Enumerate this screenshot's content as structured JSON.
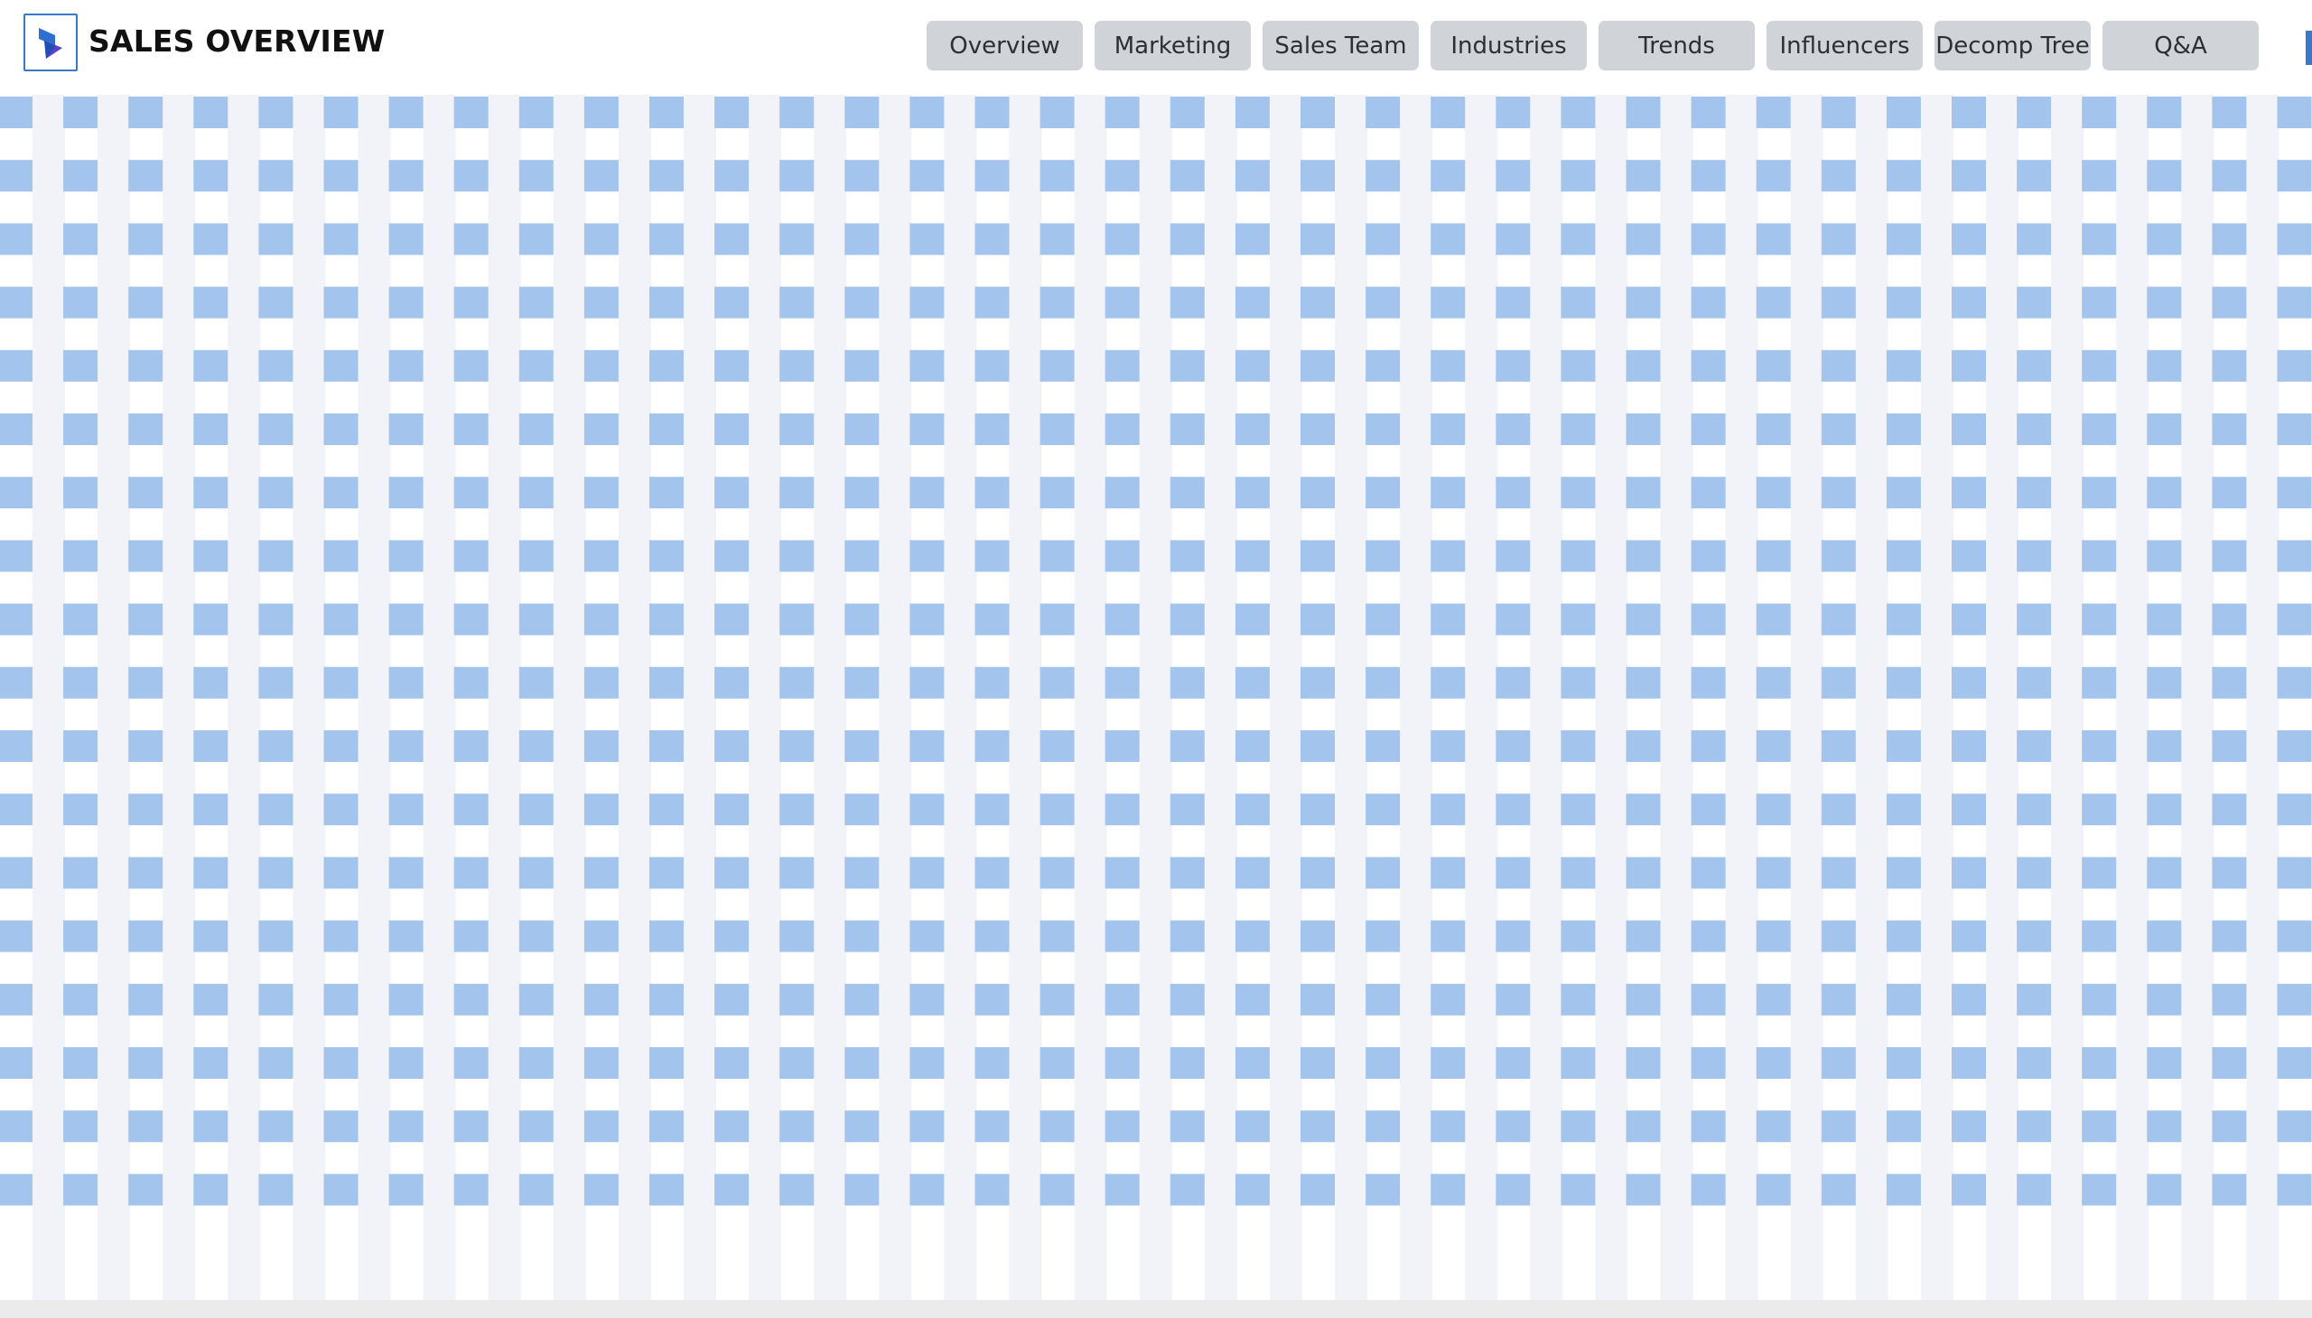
{
  "header": {
    "title": "SALES OVERVIEW",
    "logo_icon": "power-bi-logo-icon"
  },
  "tabs": [
    {
      "id": "overview",
      "label": "Overview"
    },
    {
      "id": "marketing",
      "label": "Marketing"
    },
    {
      "id": "sales-team",
      "label": "Sales Team"
    },
    {
      "id": "industries",
      "label": "Industries"
    },
    {
      "id": "trends",
      "label": "Trends"
    },
    {
      "id": "influencers",
      "label": "Influencers"
    },
    {
      "id": "decomp-tree",
      "label": "Decomp Tree"
    },
    {
      "id": "qa",
      "label": "Q&A"
    }
  ],
  "colors": {
    "accent": "#3a78c8",
    "tab_bg": "#d0d3d8",
    "pattern_square": "#a3c4ec",
    "pattern_stripe": "#f2f3f8",
    "footer_bg": "#ebebeb"
  }
}
